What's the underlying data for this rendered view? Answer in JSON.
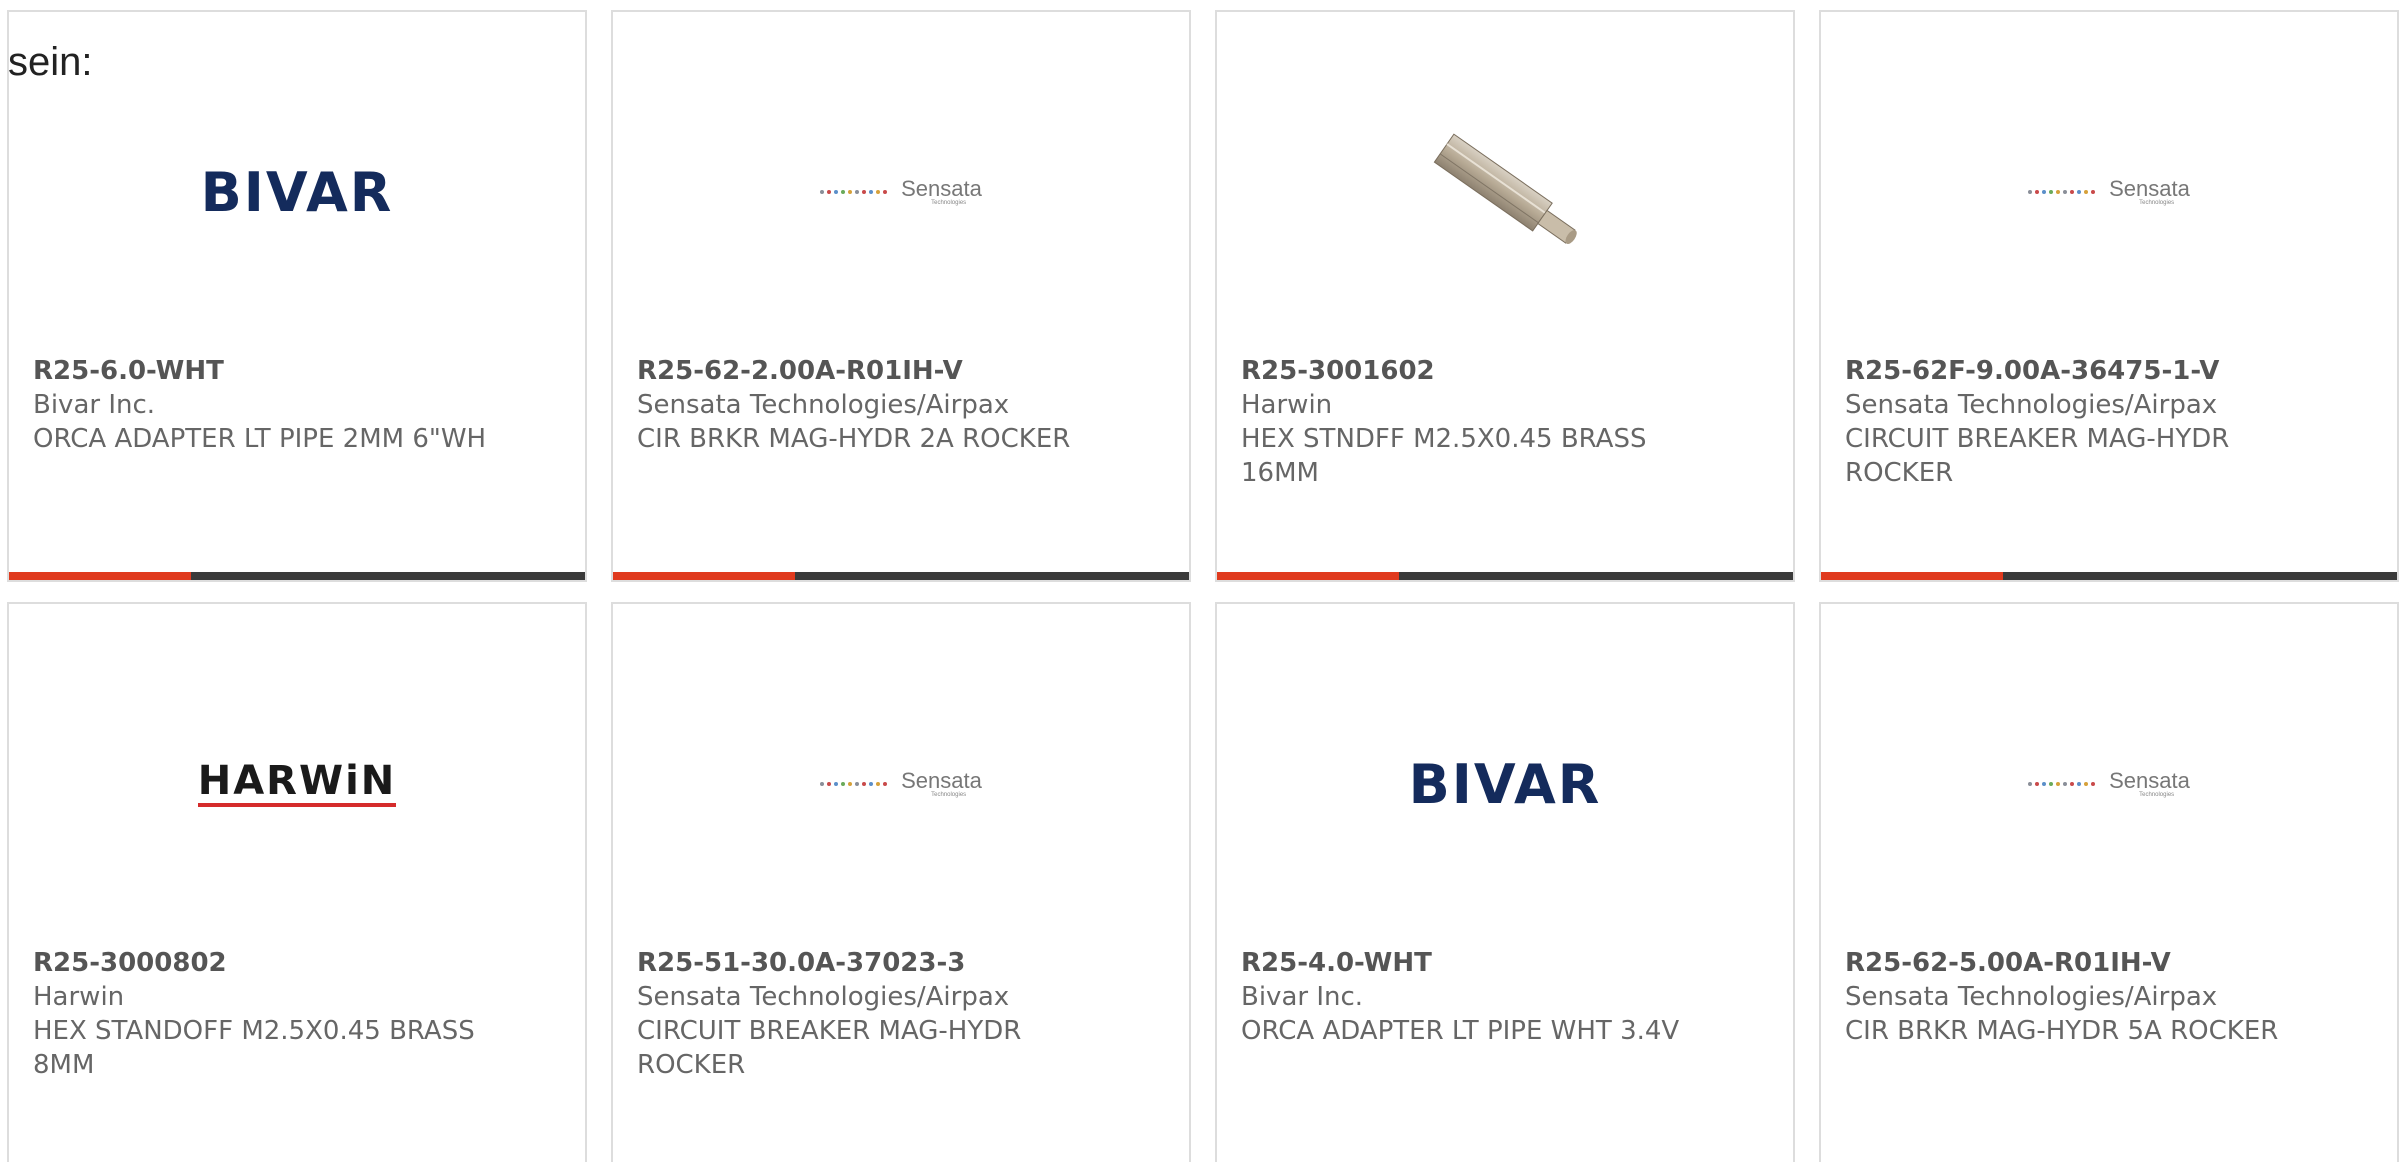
{
  "intro_text": "sein:",
  "colors": {
    "accent_bar": "#e03a1e",
    "bar": "#3a3a3a",
    "bivar_blue": "#142b5c",
    "harwin_red": "#d52b2b"
  },
  "products": [
    {
      "part_number": "R25-6.0-WHT",
      "manufacturer": "Bivar Inc.",
      "description": "ORCA ADAPTER LT PIPE 2MM 6\"WH",
      "image": "bivar-logo",
      "logo_text": "BIVAR"
    },
    {
      "part_number": "R25-62-2.00A-R01IH-V",
      "manufacturer": "Sensata Technologies/Airpax",
      "description": "CIR BRKR MAG-HYDR 2A ROCKER",
      "image": "sensata-logo",
      "logo_text": "Sensata",
      "logo_sub": "Technologies"
    },
    {
      "part_number": "R25-3001602",
      "manufacturer": "Harwin",
      "description": "HEX STNDFF M2.5X0.45 BRASS 16MM",
      "image": "hex-standoff-photo"
    },
    {
      "part_number": "R25-62F-9.00A-36475-1-V",
      "manufacturer": "Sensata Technologies/Airpax",
      "description": "CIRCUIT BREAKER MAG-HYDR ROCKER",
      "image": "sensata-logo",
      "logo_text": "Sensata",
      "logo_sub": "Technologies"
    },
    {
      "part_number": "R25-3000802",
      "manufacturer": "Harwin",
      "description": "HEX STANDOFF M2.5X0.45 BRASS 8MM",
      "image": "harwin-logo",
      "logo_text": "HARWiN"
    },
    {
      "part_number": "R25-51-30.0A-37023-3",
      "manufacturer": "Sensata Technologies/Airpax",
      "description": "CIRCUIT BREAKER MAG-HYDR ROCKER",
      "image": "sensata-logo",
      "logo_text": "Sensata",
      "logo_sub": "Technologies"
    },
    {
      "part_number": "R25-4.0-WHT",
      "manufacturer": "Bivar Inc.",
      "description": "ORCA ADAPTER LT PIPE WHT 3.4V",
      "image": "bivar-logo",
      "logo_text": "BIVAR"
    },
    {
      "part_number": "R25-62-5.00A-R01IH-V",
      "manufacturer": "Sensata Technologies/Airpax",
      "description": "CIR BRKR MAG-HYDR 5A ROCKER",
      "image": "sensata-logo",
      "logo_text": "Sensata",
      "logo_sub": "Technologies"
    }
  ]
}
